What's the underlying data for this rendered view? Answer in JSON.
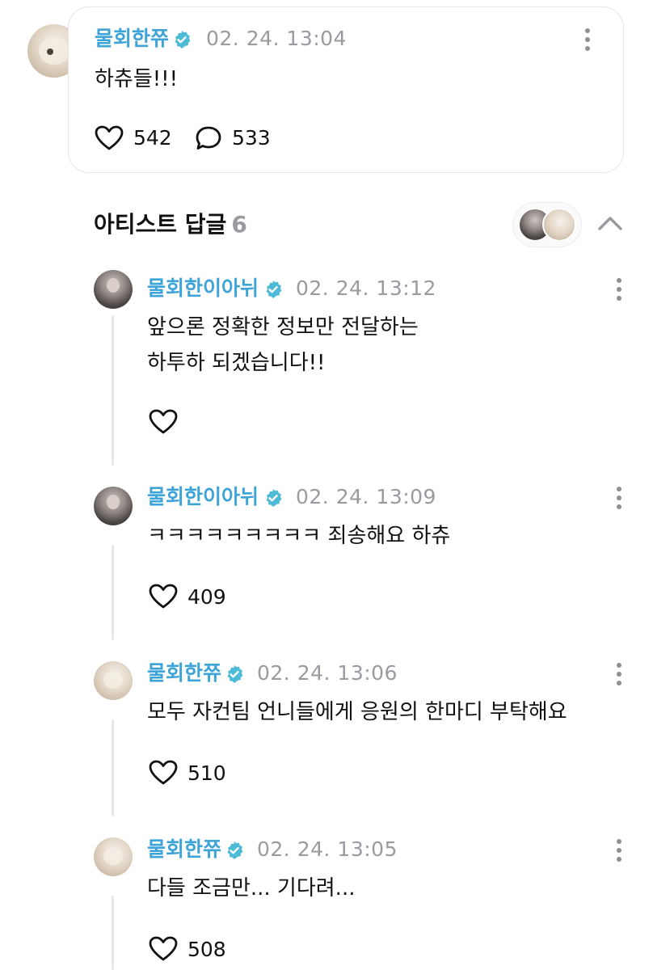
{
  "main_post": {
    "author": "물회한쮸",
    "timestamp": "02. 24. 13:04",
    "text": "하츄들!!!",
    "likes": "542",
    "comments": "533",
    "avatar_icon": "dog-avatar",
    "verified_color": "#4dbbd8"
  },
  "replies_section": {
    "title": "아티스트 답글",
    "count": "6",
    "collapse_icon": "chevron-up-icon"
  },
  "replies": [
    {
      "author": "물회한이아뉘",
      "timestamp": "02. 24. 13:12",
      "lines": [
        "앞으론 정확한 정보만 전달하는",
        "하투하 되겠습니다!!"
      ],
      "likes": "",
      "avatar_icon": "person-avatar"
    },
    {
      "author": "물회한이아뉘",
      "timestamp": "02. 24. 13:09",
      "lines": [
        "ㅋㅋㅋㅋㅋㅋㅋㅋㅋ 죄송해요 하츄"
      ],
      "likes": "409",
      "avatar_icon": "person-avatar"
    },
    {
      "author": "물회한쮸",
      "timestamp": "02. 24. 13:06",
      "lines": [
        "모두 자컨팀 언니들에게 응원의 한마디 부탁해요"
      ],
      "likes": "510",
      "avatar_icon": "dog-avatar"
    },
    {
      "author": "물회한쮸",
      "timestamp": "02. 24. 13:05",
      "lines": [
        "다들 조금만... 기다려..."
      ],
      "likes": "508",
      "avatar_icon": "dog-avatar"
    }
  ],
  "colors": {
    "name": "#3ea4d8",
    "timestamp": "#9a9aa0",
    "thread_line": "#e8e8ec"
  }
}
